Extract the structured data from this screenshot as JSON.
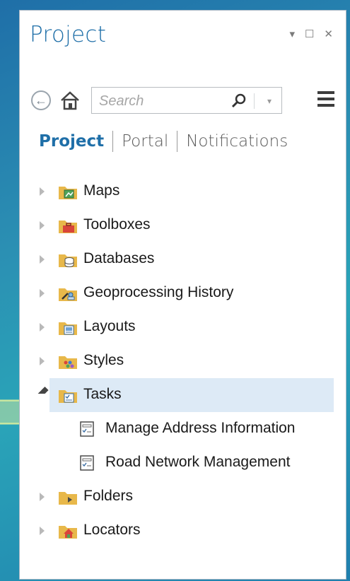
{
  "pane": {
    "title": "Project"
  },
  "search": {
    "placeholder": "Search"
  },
  "tabs": [
    {
      "label": "Project",
      "active": true
    },
    {
      "label": "Portal",
      "active": false
    },
    {
      "label": "Notifications",
      "active": false
    }
  ],
  "tree": {
    "items": [
      {
        "label": "Maps",
        "icon": "maps-folder-icon"
      },
      {
        "label": "Toolboxes",
        "icon": "toolboxes-folder-icon"
      },
      {
        "label": "Databases",
        "icon": "databases-folder-icon"
      },
      {
        "label": "Geoprocessing History",
        "icon": "geoprocessing-folder-icon"
      },
      {
        "label": "Layouts",
        "icon": "layouts-folder-icon"
      },
      {
        "label": "Styles",
        "icon": "styles-folder-icon"
      },
      {
        "label": "Tasks",
        "icon": "tasks-folder-icon",
        "expanded": true,
        "selected": true,
        "children": [
          {
            "label": "Manage Address Information",
            "icon": "task-item-icon"
          },
          {
            "label": "Road Network Management",
            "icon": "task-item-icon"
          }
        ]
      },
      {
        "label": "Folders",
        "icon": "folders-folder-icon"
      },
      {
        "label": "Locators",
        "icon": "locators-folder-icon"
      }
    ]
  },
  "colors": {
    "accent": "#1f6fa8",
    "selection": "#ddeaf6",
    "folder": "#e8b84a",
    "callout": "#c8e6a0"
  }
}
